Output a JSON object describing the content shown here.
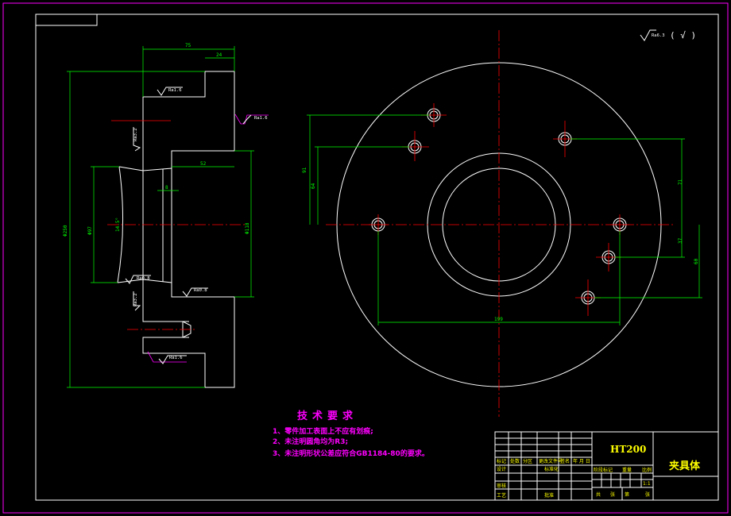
{
  "drawing": {
    "roughness_general": "Ra6.3",
    "roughness_general_suffix": "( √ )",
    "material": "HT200",
    "part_name": "夹具体"
  },
  "section_view": {
    "dims": {
      "overall_width": "75",
      "flange_thickness": "24",
      "bore_depth": "52",
      "groove_width": "8",
      "outer_dia": "Φ250",
      "inner_dia": "Φ97",
      "bore_dia": "Φ118",
      "angle": "14.5°"
    },
    "roughness": {
      "top_face": "Ra1.6",
      "right_face": "Ra1.6",
      "left_upper": "Ra3.2",
      "left_lower": "Ra3.2",
      "taper": "Ra0.8",
      "bore": "Ra0.8",
      "bottom_face": "Ra1.6"
    }
  },
  "plan_view": {
    "dims": {
      "h91": "91",
      "h64": "64",
      "h71": "71",
      "h37": "37",
      "h60": "60",
      "w199": "199"
    }
  },
  "notes": {
    "title": "技术要求",
    "items": [
      "1、零件加工表面上不应有划痕;",
      "2、未注明圆角均为R3;",
      "3、未注明形状公差应符合GB1184-80的要求。"
    ]
  },
  "title_block": {
    "headers": [
      "标记",
      "处数",
      "分区",
      "更改文件号",
      "签名",
      "年 月 日"
    ],
    "row_design": [
      "设计",
      "标准化"
    ],
    "row_review": [
      "审核"
    ],
    "row_craft": [
      "工艺",
      "批准"
    ],
    "extra": [
      "阶段标记",
      "重量",
      "比例",
      "共",
      "张",
      "第",
      "张"
    ],
    "scale": "1:1",
    "labels2": [
      "(签名)",
      "(年月日)"
    ]
  },
  "colors": {
    "background": "#000000",
    "outline": "#ffffff",
    "dimension": "#00ff00",
    "centerline": "#ff0000",
    "notes": "#ff00ff",
    "title_block": "#ffff00"
  }
}
